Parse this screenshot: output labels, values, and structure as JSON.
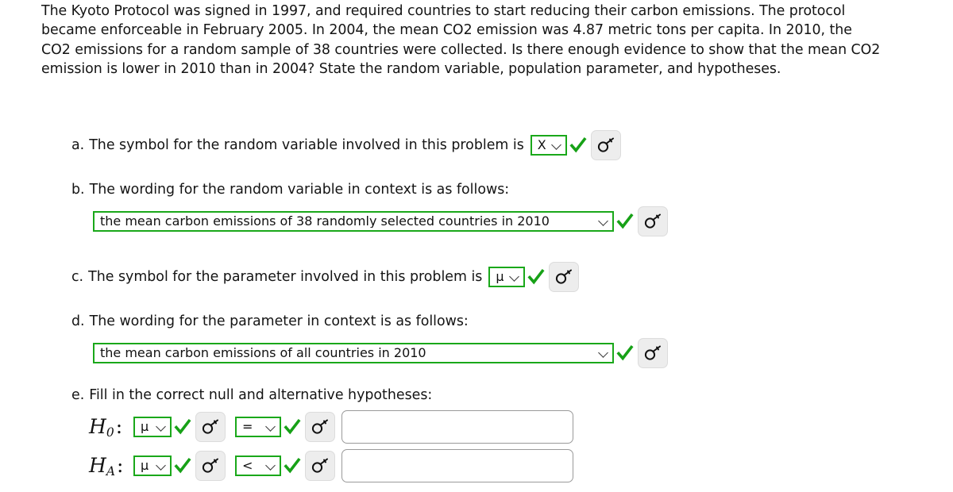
{
  "intro": {
    "paragraph": "The Kyoto Protocol was signed in 1997, and required countries to start reducing their carbon emissions. The protocol became enforceable in February 2005. In 2004, the mean CO2 emission was 4.87 metric tons per capita. In 2010, the CO2 emissions for a random sample of 38 countries were collected. Is there enough evidence to show that the mean CO2 emission is lower in 2010 than in 2004? State the random variable, population parameter, and hypotheses."
  },
  "colors": {
    "valid_green": "#1aa81a",
    "check_green": "#17a117",
    "button_gray": "#ededed",
    "input_border": "#9a9a9a",
    "text": "#141414"
  },
  "icons": {
    "key": "key-icon",
    "check": "check-icon",
    "chevron": "chevron-down-icon"
  },
  "questions": {
    "a": {
      "label": "a.",
      "text": "The symbol for the random variable involved in this problem is",
      "select_value": "X̄",
      "status": "correct"
    },
    "b": {
      "label": "b.",
      "text": "The wording for the random variable in context is as follows:",
      "select_value": "the mean carbon emissions of 38 randomly selected countries in 2010",
      "status": "correct"
    },
    "c": {
      "label": "c.",
      "text": "The symbol for the parameter involved in this problem is",
      "select_value": "μ",
      "status": "correct"
    },
    "d": {
      "label": "d.",
      "text": "The wording for the parameter in context is as follows:",
      "select_value": "the mean carbon emissions of all countries in 2010",
      "status": "correct"
    },
    "e": {
      "label": "e.",
      "text": "Fill in the correct null and alternative hypotheses:",
      "rows": [
        {
          "name": "null",
          "label_base": "H",
          "label_sub": "0",
          "symbol_value": "μ",
          "operator_value": "=",
          "input_value": "",
          "input_placeholder": ""
        },
        {
          "name": "alternative",
          "label_base": "H",
          "label_sub": "A",
          "symbol_value": "μ",
          "operator_value": "<",
          "input_value": "",
          "input_placeholder": ""
        }
      ]
    }
  }
}
